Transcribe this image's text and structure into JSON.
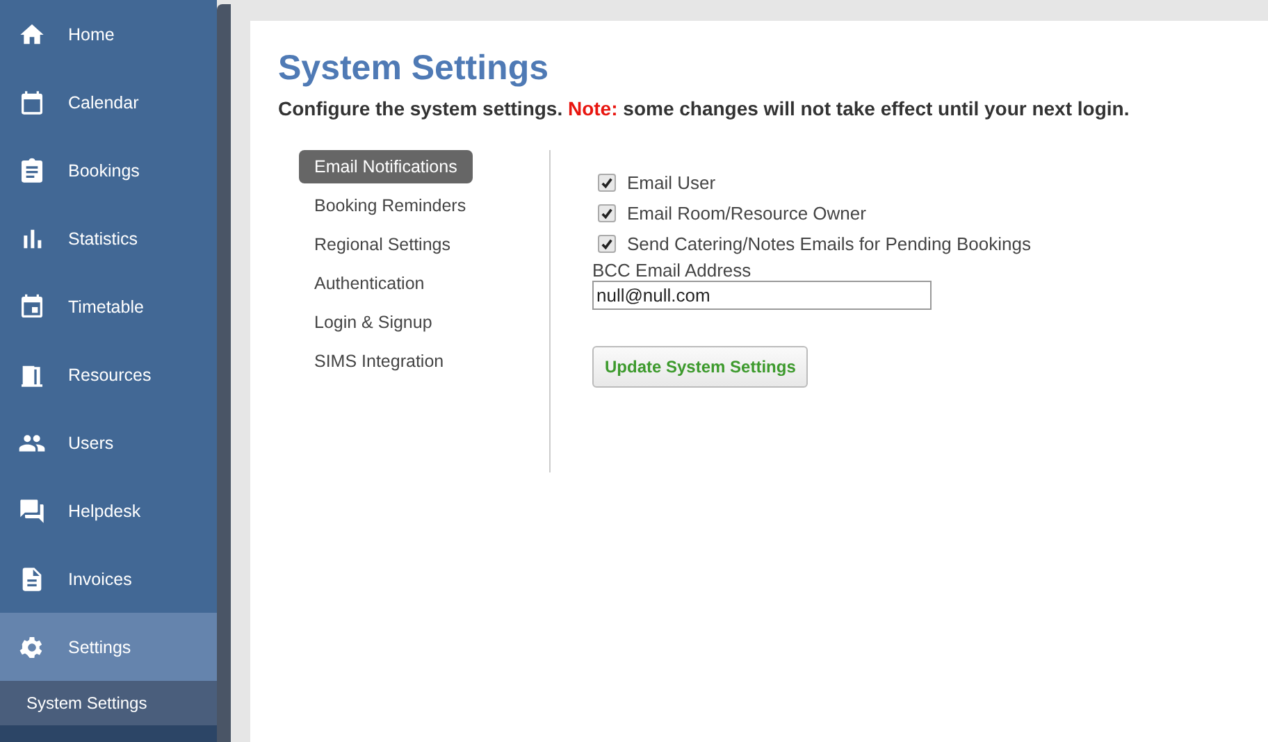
{
  "sidebar": {
    "items": [
      {
        "label": "Home",
        "kind": "home",
        "selected": false
      },
      {
        "label": "Calendar",
        "kind": "calendar",
        "selected": false
      },
      {
        "label": "Bookings",
        "kind": "clipboard",
        "selected": false
      },
      {
        "label": "Statistics",
        "kind": "bars",
        "selected": false
      },
      {
        "label": "Timetable",
        "kind": "event",
        "selected": false
      },
      {
        "label": "Resources",
        "kind": "door",
        "selected": false
      },
      {
        "label": "Users",
        "kind": "people",
        "selected": false
      },
      {
        "label": "Helpdesk",
        "kind": "chat",
        "selected": false
      },
      {
        "label": "Invoices",
        "kind": "document",
        "selected": false
      },
      {
        "label": "Settings",
        "kind": "gear",
        "selected": true
      }
    ],
    "subitems": [
      {
        "label": "System Settings",
        "selected": true
      }
    ]
  },
  "page": {
    "title": "System Settings",
    "subtitle": "Configure the system settings. **Note:** some changes will not take effect until your next login."
  },
  "settings_nav": [
    {
      "label": "Email Notifications",
      "selected": true
    },
    {
      "label": "Booking Reminders",
      "selected": false
    },
    {
      "label": "Regional Settings",
      "selected": false
    },
    {
      "label": "Authentication",
      "selected": false
    },
    {
      "label": "Login & Signup",
      "selected": false
    },
    {
      "label": "SIMS Integration",
      "selected": false
    }
  ],
  "options": [
    {
      "label": "Email User",
      "checked": true
    },
    {
      "label": "Email Room/Resource Owner",
      "checked": true
    },
    {
      "label": "Send Catering/Notes Emails for Pending Bookings",
      "checked": true
    }
  ],
  "bcc": {
    "label": "BCC Email Address",
    "value": "null@null.com"
  },
  "submit": "Update System Settings"
}
